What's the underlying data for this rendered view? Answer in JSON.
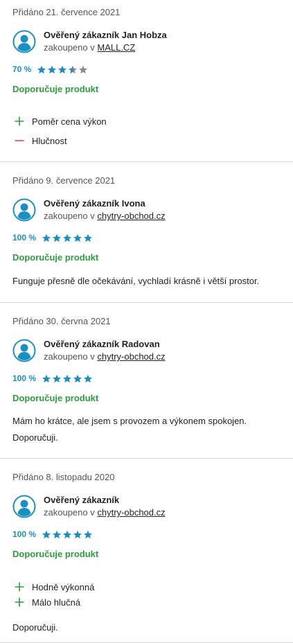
{
  "reviews": [
    {
      "date": "Přidáno 21. července 2021",
      "author": "Ověřený zákazník Jan Hobza",
      "purchased_prefix": "zakoupeno v",
      "shop": "MALL.CZ",
      "rating_text": "70 %",
      "rating_value": 3.5,
      "recommend": "Doporučuje produkt",
      "pros": [
        "Poměr cena výkon"
      ],
      "cons": [
        "Hlučnost"
      ],
      "comment": ""
    },
    {
      "date": "Přidáno 9. července 2021",
      "author": "Ověřený zákazník Ivona",
      "purchased_prefix": "zakoupeno v",
      "shop": "chytry-obchod.cz",
      "rating_text": "100 %",
      "rating_value": 5,
      "recommend": "Doporučuje produkt",
      "pros": [],
      "cons": [],
      "comment": "Funguje přesně dle očekávání, vychladí krásně i větší prostor."
    },
    {
      "date": "Přidáno 30. června 2021",
      "author": "Ověřený zákazník Radovan",
      "purchased_prefix": "zakoupeno v",
      "shop": "chytry-obchod.cz",
      "rating_text": "100 %",
      "rating_value": 5,
      "recommend": "Doporučuje produkt",
      "pros": [],
      "cons": [],
      "comment": "Mám ho krátce, ale jsem s provozem a výkonem spokojen. Doporučuji."
    },
    {
      "date": "Přidáno 8. listopadu 2020",
      "author": "Ověřený zákazník",
      "purchased_prefix": "zakoupeno v",
      "shop": "chytry-obchod.cz",
      "rating_text": "100 %",
      "rating_value": 5,
      "recommend": "Doporučuje produkt",
      "pros": [
        "Hodně výkonná",
        "Málo hlučná"
      ],
      "cons": [],
      "comment": "Doporučuji."
    }
  ],
  "colors": {
    "accent_blue": "#1a8fc2",
    "recommend_green": "#2d9c3c",
    "pro_green": "#2d9c3c",
    "con_red": "#e0474c",
    "star_empty": "#8a8a8a"
  },
  "icons": {
    "avatar": "user-avatar-icon",
    "pro": "plus-icon",
    "con": "minus-icon",
    "star": "star-icon"
  }
}
